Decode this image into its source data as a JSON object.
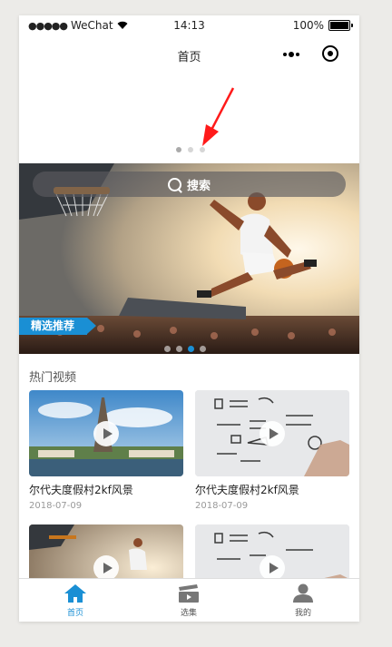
{
  "status_bar": {
    "carrier": "WeChat",
    "time": "14:13",
    "battery": "100%"
  },
  "nav": {
    "title": "首页"
  },
  "banner": {
    "search_label": "搜索",
    "tag": "精选推荐"
  },
  "section": {
    "title": "热门视频"
  },
  "videos": [
    {
      "title": "尔代夫度假村2kf风景",
      "date": "2018-07-09"
    },
    {
      "title": "尔代夫度假村2kf风景",
      "date": "2018-07-09"
    }
  ],
  "tabs": [
    {
      "label": "首页",
      "icon": "home-icon",
      "active": true
    },
    {
      "label": "选集",
      "icon": "film-icon",
      "active": false
    },
    {
      "label": "我的",
      "icon": "user-icon",
      "active": false
    }
  ],
  "colors": {
    "accent": "#1a8fd4",
    "annotation": "#ff0000"
  }
}
